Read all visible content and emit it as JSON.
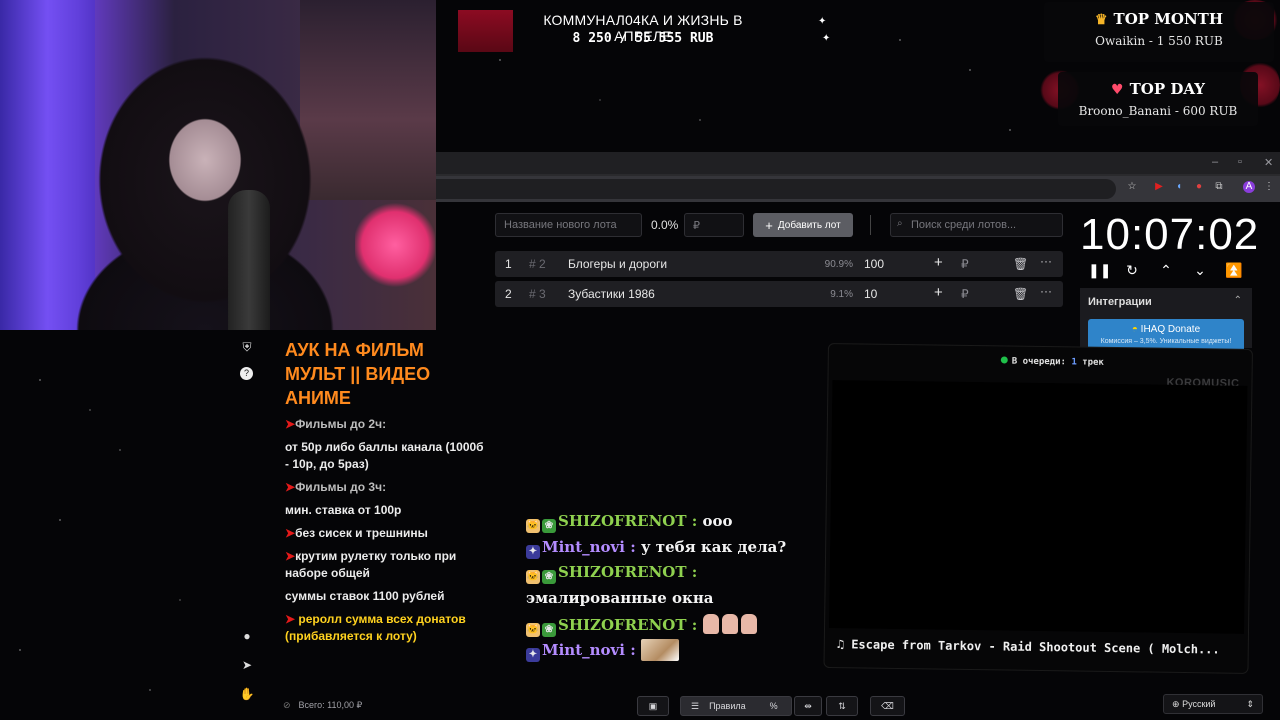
{
  "goal": {
    "title": "КОММУНАЛ04КА И ЖИЗНЬ В АПРЕЛЕ",
    "amount": "8 250 / 55 555 RUB",
    "progress": 0.1485
  },
  "top_month": {
    "title": "TOP MONTH",
    "value": "Owaikin - 1 550 RUB",
    "icon": "crown-icon"
  },
  "top_day": {
    "title": "TOP DAY",
    "value": "Broono_Banani - 600 RUB",
    "icon": "heart-icon"
  },
  "toolbar": {
    "lot_name_placeholder": "Название нового лота",
    "percent": "0.0%",
    "amount_placeholder": "₽",
    "add_label": "Добавить лот",
    "search_placeholder": "Поиск среди лотов..."
  },
  "lots": [
    {
      "num": "1",
      "id": "# 2",
      "name": "Блогеры и дороги",
      "percent": "90.9%",
      "amount": "100"
    },
    {
      "num": "2",
      "id": "# 3",
      "name": "Зубастики 1986",
      "percent": "9.1%",
      "amount": "10"
    }
  ],
  "timer": {
    "value": "10:07:02"
  },
  "integrations": {
    "title": "Интеграции",
    "donate_title": "IHAQ Donate",
    "donate_sub": "Комиссия – 3,5%. Уникальные виджеты!"
  },
  "player": {
    "queue_label": "В очереди:",
    "queue_count": "1",
    "queue_unit": "трек",
    "brand": "KOROMUSIC",
    "track": "Escape from Tarkov - Raid Shootout Scene ( Molch..."
  },
  "rules": {
    "title": "АУК НА ФИЛЬМ МУЛЬТ || ВИДЕО АНИМЕ",
    "l1": "Фильмы до 2ч:",
    "l2": "от 50р либо баллы канала (1000б - 10р, до 5раз)",
    "l3": "Фильмы до 3ч:",
    "l4": "мин. ставка от 100р",
    "l5": "без сисек и трешнины",
    "l6": "крутим рулетку только при наборе общей",
    "l7": "суммы ставок 1100 рублей",
    "l8": "реролл сумма всех донатов (прибавляется к лоту)"
  },
  "chat": [
    {
      "user": "SHIZOFRENOT",
      "text": "ооо"
    },
    {
      "user": "Mint_novi",
      "text": "у тебя как дела?"
    },
    {
      "user": "SHIZOFRENOT",
      "text": ""
    },
    {
      "user": "",
      "text": "эмалированные окна"
    },
    {
      "user": "SHIZOFRENOT",
      "text": ""
    },
    {
      "user": "Mint_novi",
      "text": ""
    }
  ],
  "footer": {
    "total": "Всего: 110,00 ₽",
    "rules_label": "Правила",
    "language": "Русский"
  },
  "colors": {
    "accent_orange": "#ff8a1e",
    "arrow_red": "#e41a1a",
    "donate_blue": "#2f84c9",
    "user_green": "#8fd14f",
    "user_purple": "#b48cff"
  }
}
